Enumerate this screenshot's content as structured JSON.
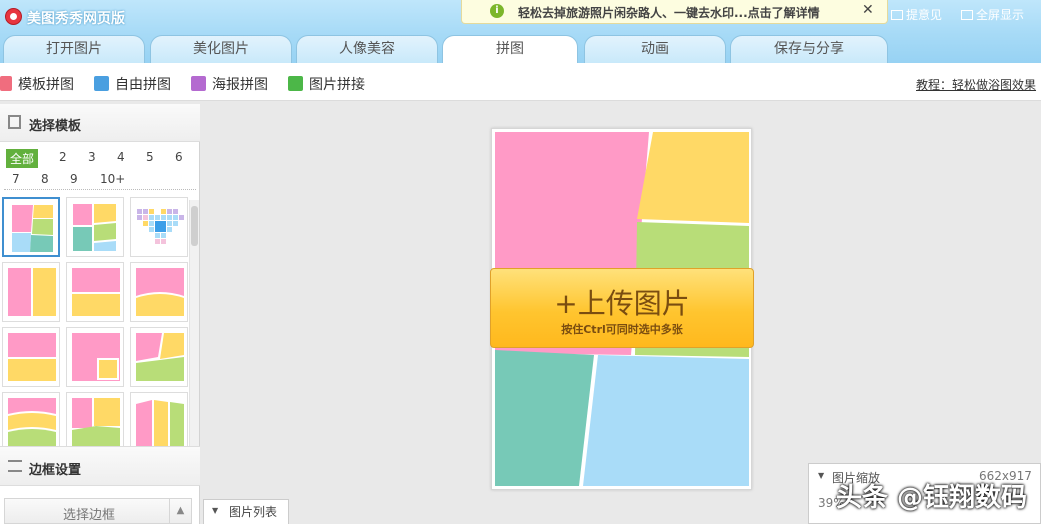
{
  "app": {
    "title": "美图秀秀网页版"
  },
  "banner": {
    "text": "轻松去掉旅游照片闲杂路人、一键去水印...点击了解详情",
    "icon": "info-icon",
    "close": "✕"
  },
  "header": {
    "feedback": "提意见",
    "fullscreen": "全屏显示"
  },
  "tabs": [
    "打开图片",
    "美化图片",
    "人像美容",
    "拼图",
    "动画",
    "保存与分享"
  ],
  "active_tab": "拼图",
  "subtoolbar": {
    "items": [
      "模板拼图",
      "自由拼图",
      "海报拼图",
      "图片拼接"
    ],
    "tutorial": "教程：轻松做浴图效果"
  },
  "template_panel": {
    "title": "选择模板",
    "filters": [
      "全部",
      "2",
      "3",
      "4",
      "5",
      "6",
      "7",
      "8",
      "9",
      "10+"
    ],
    "active_filter": "全部"
  },
  "border_panel": {
    "title": "边框设置",
    "select_label": "选择边框",
    "arrow": "▲"
  },
  "canvas": {
    "upload_label": "+上传图片",
    "upload_hint": "按住Ctrl可同时选中多张"
  },
  "bottom": {
    "photo_list": "图片列表",
    "zoom_label": "图片缩放",
    "image_size": "662x917",
    "zoom_percent": "39%"
  },
  "watermark": "头条 @钰翔数码",
  "colors": {
    "pink": "#ff9ac6",
    "yellow": "#ffd966",
    "green": "#b8dd78",
    "teal": "#77c9b7",
    "blue": "#a9dcf8",
    "accent": "#62b03d"
  }
}
